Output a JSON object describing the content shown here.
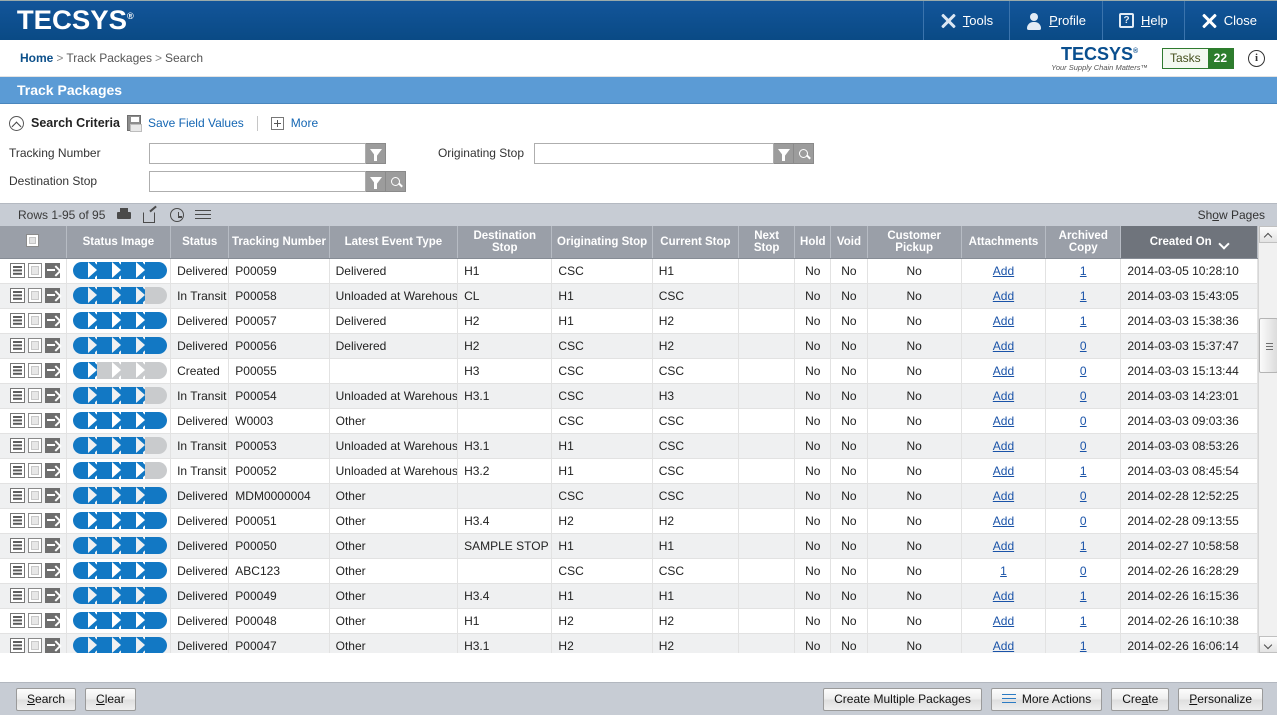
{
  "topbar": {
    "logo": "TECSYS",
    "logo_mark": "®",
    "nav": [
      {
        "label_pre": "",
        "label_u": "T",
        "label_post": "ools",
        "icon": "tools-icon",
        "name": "tools"
      },
      {
        "label_pre": "",
        "label_u": "P",
        "label_post": "rofile",
        "icon": "profile-icon",
        "name": "profile"
      },
      {
        "label_pre": "",
        "label_u": "H",
        "label_post": "elp",
        "icon": "help-icon",
        "name": "help"
      },
      {
        "label_pre": "Close",
        "label_u": "",
        "label_post": "",
        "icon": "close-icon",
        "name": "close"
      }
    ]
  },
  "breadcrumb": {
    "home": "Home",
    "sep": ">",
    "middle": "Track Packages",
    "current": "Search"
  },
  "corner": {
    "logo": "TECSYS",
    "logo_mark": "®",
    "tagline": "Your Supply Chain Matters™",
    "tasks_label": "Tasks",
    "tasks_count": "22",
    "info_icon": "info-icon"
  },
  "page": {
    "title": "Track Packages"
  },
  "search_criteria": {
    "heading": "Search Criteria",
    "save_field_values": "Save Field Values",
    "more": "More",
    "fields": [
      {
        "label": "Tracking Number",
        "value": "",
        "placeholder": "",
        "has_lookup": false
      },
      {
        "label": "Originating Stop",
        "value": "",
        "placeholder": "",
        "has_lookup": true
      },
      {
        "label": "Destination Stop",
        "value": "",
        "placeholder": "",
        "has_lookup": true
      }
    ]
  },
  "rows_bar": {
    "rows_text": "Rows 1-95 of 95",
    "icons": [
      "print-icon",
      "export-icon",
      "history-clock-icon",
      "list-menu-icon"
    ],
    "show_pages_pre": "Sh",
    "show_pages_u": "o",
    "show_pages_post": "w Pages"
  },
  "grid": {
    "columns": [
      "Status Image",
      "Status",
      "Tracking Number",
      "Latest Event Type",
      "Destination Stop",
      "Originating Stop",
      "Current Stop",
      "Next Stop",
      "Hold",
      "Void",
      "Customer Pickup",
      "Attachments",
      "Archived Copy",
      "Created On"
    ],
    "sorted_column": "Created On",
    "sort_direction": "desc",
    "rows": [
      {
        "progress": 4,
        "status": "Delivered",
        "tracking": "P00059",
        "event": "Delivered",
        "dest": "H1",
        "orig": "CSC",
        "current": "H1",
        "next": "",
        "hold": "No",
        "void": "No",
        "pickup": "No",
        "attachments": "Add",
        "archived": "1",
        "created": "2014-03-05 10:28:10"
      },
      {
        "progress": 3,
        "status": "In Transit",
        "tracking": "P00058",
        "event": "Unloaded at Warehouse",
        "dest": "CL",
        "orig": "H1",
        "current": "CSC",
        "next": "",
        "hold": "No",
        "void": "No",
        "pickup": "No",
        "attachments": "Add",
        "archived": "1",
        "created": "2014-03-03 15:43:05"
      },
      {
        "progress": 4,
        "status": "Delivered",
        "tracking": "P00057",
        "event": "Delivered",
        "dest": "H2",
        "orig": "H1",
        "current": "H2",
        "next": "",
        "hold": "No",
        "void": "No",
        "pickup": "No",
        "attachments": "Add",
        "archived": "1",
        "created": "2014-03-03 15:38:36"
      },
      {
        "progress": 4,
        "status": "Delivered",
        "tracking": "P00056",
        "event": "Delivered",
        "dest": "H2",
        "orig": "CSC",
        "current": "H2",
        "next": "",
        "hold": "No",
        "void": "No",
        "pickup": "No",
        "attachments": "Add",
        "archived": "0",
        "created": "2014-03-03 15:37:47"
      },
      {
        "progress": 1,
        "status": "Created",
        "tracking": "P00055",
        "event": "",
        "dest": "H3",
        "orig": "CSC",
        "current": "CSC",
        "next": "",
        "hold": "No",
        "void": "No",
        "pickup": "No",
        "attachments": "Add",
        "archived": "0",
        "created": "2014-03-03 15:13:44"
      },
      {
        "progress": 3,
        "status": "In Transit",
        "tracking": "P00054",
        "event": "Unloaded at Warehouse",
        "dest": "H3.1",
        "orig": "CSC",
        "current": "H3",
        "next": "",
        "hold": "No",
        "void": "No",
        "pickup": "No",
        "attachments": "Add",
        "archived": "0",
        "created": "2014-03-03 14:23:01"
      },
      {
        "progress": 4,
        "status": "Delivered",
        "tracking": "W0003",
        "event": "Other",
        "dest": "",
        "orig": "CSC",
        "current": "CSC",
        "next": "",
        "hold": "No",
        "void": "No",
        "pickup": "No",
        "attachments": "Add",
        "archived": "0",
        "created": "2014-03-03 09:03:36"
      },
      {
        "progress": 3,
        "status": "In Transit",
        "tracking": "P00053",
        "event": "Unloaded at Warehouse",
        "dest": "H3.1",
        "orig": "H1",
        "current": "CSC",
        "next": "",
        "hold": "No",
        "void": "No",
        "pickup": "No",
        "attachments": "Add",
        "archived": "0",
        "created": "2014-03-03 08:53:26"
      },
      {
        "progress": 3,
        "status": "In Transit",
        "tracking": "P00052",
        "event": "Unloaded at Warehouse",
        "dest": "H3.2",
        "orig": "H1",
        "current": "CSC",
        "next": "",
        "hold": "No",
        "void": "No",
        "pickup": "No",
        "attachments": "Add",
        "archived": "1",
        "created": "2014-03-03 08:45:54"
      },
      {
        "progress": 4,
        "status": "Delivered",
        "tracking": "MDM0000004",
        "event": "Other",
        "dest": "",
        "orig": "CSC",
        "current": "CSC",
        "next": "",
        "hold": "No",
        "void": "No",
        "pickup": "No",
        "attachments": "Add",
        "archived": "0",
        "created": "2014-02-28 12:52:25"
      },
      {
        "progress": 4,
        "status": "Delivered",
        "tracking": "P00051",
        "event": "Other",
        "dest": "H3.4",
        "orig": "H2",
        "current": "H2",
        "next": "",
        "hold": "No",
        "void": "No",
        "pickup": "No",
        "attachments": "Add",
        "archived": "0",
        "created": "2014-02-28 09:13:55"
      },
      {
        "progress": 4,
        "status": "Delivered",
        "tracking": "P00050",
        "event": "Other",
        "dest": "SAMPLE STOP",
        "orig": "H1",
        "current": "H1",
        "next": "",
        "hold": "No",
        "void": "No",
        "pickup": "No",
        "attachments": "Add",
        "archived": "1",
        "created": "2014-02-27 10:58:58"
      },
      {
        "progress": 4,
        "status": "Delivered",
        "tracking": "ABC123",
        "event": "Other",
        "dest": "",
        "orig": "CSC",
        "current": "CSC",
        "next": "",
        "hold": "No",
        "void": "No",
        "pickup": "No",
        "attachments": "1",
        "archived": "0",
        "created": "2014-02-26 16:28:29"
      },
      {
        "progress": 4,
        "status": "Delivered",
        "tracking": "P00049",
        "event": "Other",
        "dest": "H3.4",
        "orig": "H1",
        "current": "H1",
        "next": "",
        "hold": "No",
        "void": "No",
        "pickup": "No",
        "attachments": "Add",
        "archived": "1",
        "created": "2014-02-26 16:15:36"
      },
      {
        "progress": 4,
        "status": "Delivered",
        "tracking": "P00048",
        "event": "Other",
        "dest": "H1",
        "orig": "H2",
        "current": "H2",
        "next": "",
        "hold": "No",
        "void": "No",
        "pickup": "No",
        "attachments": "Add",
        "archived": "1",
        "created": "2014-02-26 16:10:38"
      },
      {
        "progress": 4,
        "status": "Delivered",
        "tracking": "P00047",
        "event": "Other",
        "dest": "H3.1",
        "orig": "H2",
        "current": "H2",
        "next": "",
        "hold": "No",
        "void": "No",
        "pickup": "No",
        "attachments": "Add",
        "archived": "1",
        "created": "2014-02-26 16:06:14"
      }
    ]
  },
  "footer": {
    "left_buttons": [
      {
        "pre": "",
        "u": "S",
        "post": "earch",
        "name": "search-button"
      },
      {
        "pre": "",
        "u": "C",
        "post": "lear",
        "name": "clear-button"
      }
    ],
    "right_buttons": [
      {
        "pre": "Create Multiple Packages",
        "u": "",
        "post": "",
        "name": "create-multiple-packages-button",
        "icon": ""
      },
      {
        "pre": "More Actions",
        "u": "",
        "post": "",
        "name": "more-actions-button",
        "icon": "hamburger-icon"
      },
      {
        "pre": "Cre",
        "u": "a",
        "post": "te",
        "name": "create-button",
        "icon": ""
      },
      {
        "pre": "",
        "u": "P",
        "post": "ersonalize",
        "name": "personalize-button",
        "icon": ""
      }
    ]
  },
  "colors": {
    "brand_blue": "#0a4f8f",
    "title_blue": "#5b9bd5",
    "progress_on": "#1278c4",
    "progress_off": "#c9cbcd",
    "link": "#1a53a8",
    "toolbar_grey": "#c7ccd4",
    "header_grey": "#9a9fa8",
    "header_sorted": "#6f747c"
  }
}
